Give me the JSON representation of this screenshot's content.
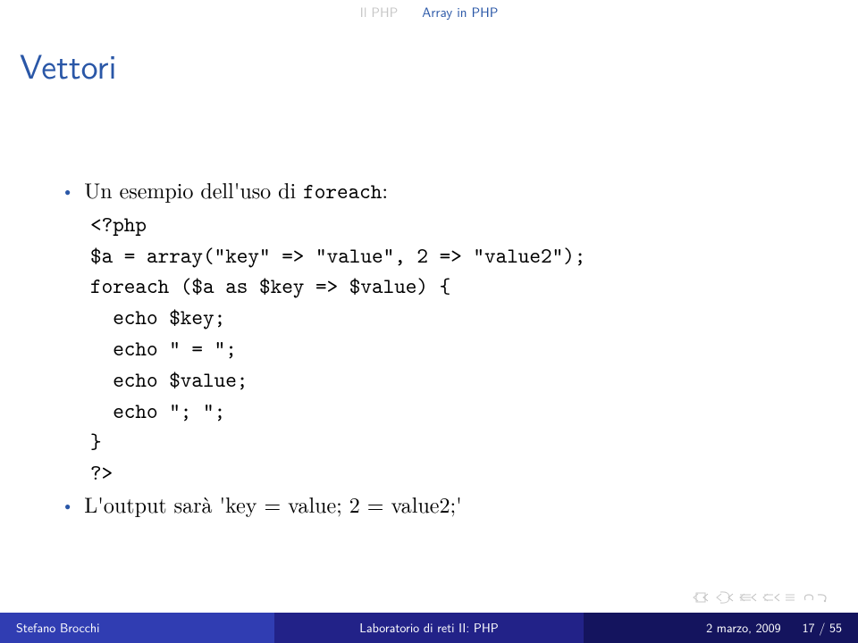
{
  "header": {
    "sec1": "Il PHP",
    "sec2": "Array in PHP"
  },
  "title": "Vettori",
  "bullets": {
    "b1_prefix": "Un esempio dell'uso di ",
    "b1_code": "foreach",
    "b1_suffix": ":",
    "b2_prefix": "L'output sarà ",
    "b2_value": "'key = value; 2 = value2;'"
  },
  "code": {
    "l1": "<?php",
    "l2": "$a = array(\"key\" => \"value\", 2 => \"value2\");",
    "l3": "foreach ($a as $key => $value) {",
    "l4": "  echo $key;",
    "l5": "  echo \" = \";",
    "l6": "  echo $value;",
    "l7": "  echo \"; \";",
    "l8": "}",
    "l9": "?>"
  },
  "footer": {
    "author": "Stefano Brocchi",
    "center": "Laboratorio di reti II: PHP",
    "date": "2 marzo, 2009",
    "page": "17 / 55"
  }
}
